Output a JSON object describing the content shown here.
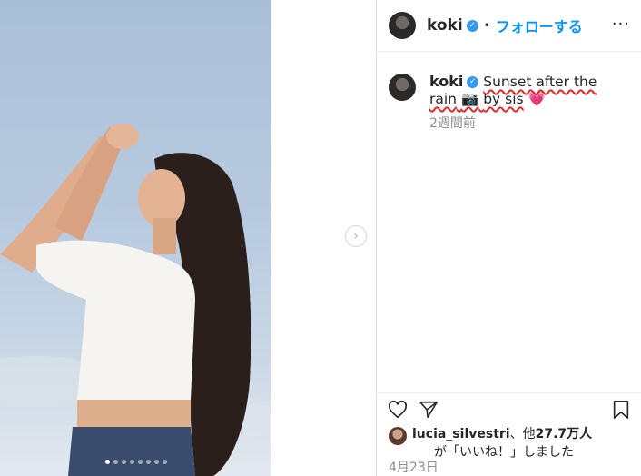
{
  "post": {
    "header": {
      "username": "koki",
      "verified_glyph": "✓",
      "separator": "•",
      "follow_label": "フォローする",
      "more_glyph": "···"
    },
    "caption": {
      "username": "koki",
      "verified_glyph": "✓",
      "text_part1": "Sunset after the rain",
      "camera_glyph": "📷",
      "text_part2": "by sis",
      "emoji": "💗",
      "time": "2週間前"
    },
    "likes": {
      "liker": "lucia_silvestri",
      "joiner": "、他",
      "count": "27.7万人",
      "suffix": "が「いいね！」しました"
    },
    "date": "4月23日",
    "carousel": {
      "slides": 8,
      "active": 1,
      "next_glyph": "›"
    },
    "icons": {
      "like": "heart-icon",
      "share": "send-icon",
      "save": "bookmark-icon",
      "next": "chevron-right-icon"
    },
    "colors": {
      "accent": "#0095f6",
      "verified": "#3897f0",
      "underline": "#e02a2a",
      "muted": "#8e8e8e"
    }
  }
}
